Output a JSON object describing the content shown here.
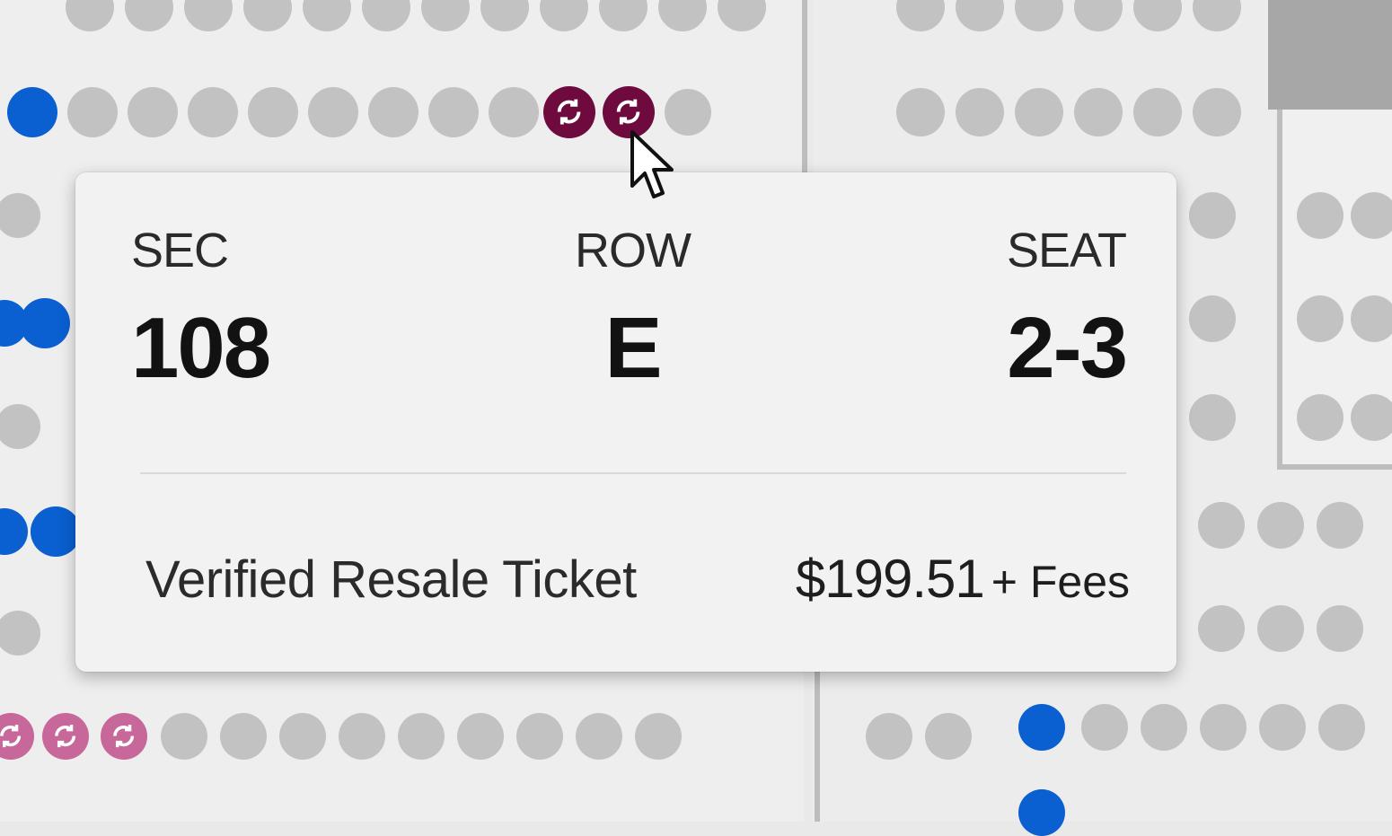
{
  "tooltip": {
    "section_label": "SEC",
    "section_value": "108",
    "row_label": "ROW",
    "row_value": "E",
    "seat_label": "SEAT",
    "seat_value": "2-3",
    "ticket_type": "Verified Resale Ticket",
    "price": "$199.51",
    "fees": "+ Fees"
  },
  "colors": {
    "available_seat": "#0a5fd1",
    "unavailable_seat": "#c2c2c2",
    "selected_resale_seat": "#6e0a3d",
    "resale_seat": "#c8679a"
  },
  "icons": {
    "resale_seat": "resale-arrows-icon",
    "cursor": "mouse-pointer-icon"
  }
}
